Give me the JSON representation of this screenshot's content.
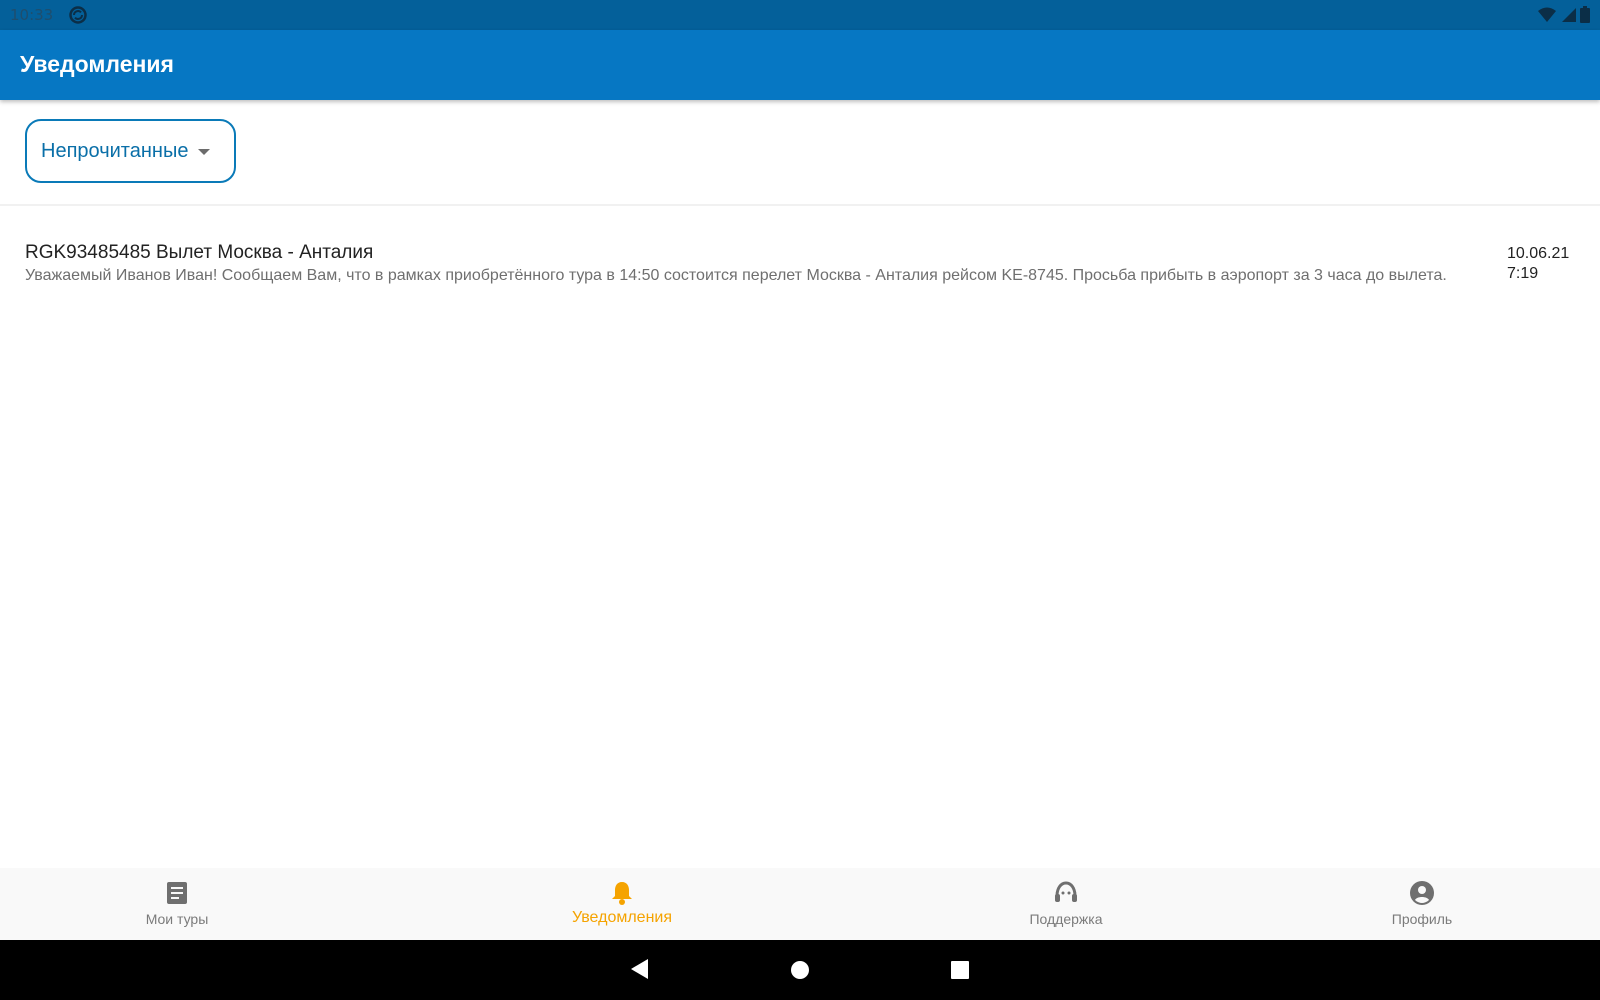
{
  "status_bar": {
    "time": "10:33"
  },
  "app_bar": {
    "title": "Уведомления"
  },
  "filter": {
    "selected": "Непрочитанные"
  },
  "notifications": [
    {
      "title": "RGK93485485 Вылет Москва - Анталия",
      "body": "Уважаемый Иванов Иван! Сообщаем Вам, что в рамках приобретённого тура в 14:50 состоится перелет Москва - Анталия рейсом KE-8745. Просьба прибыть в аэропорт за 3 часа до вылета.",
      "date": "10.06.21",
      "time": "7:19"
    }
  ],
  "bottom_nav": {
    "items": [
      {
        "label": "Мои туры",
        "icon": "document-icon",
        "active": false
      },
      {
        "label": "Уведомления",
        "icon": "bell-icon",
        "active": true
      },
      {
        "label": "Поддержка",
        "icon": "headset-icon",
        "active": false
      },
      {
        "label": "Профиль",
        "icon": "account-circle-icon",
        "active": false
      }
    ]
  },
  "colors": {
    "status_bar": "#04609a",
    "app_bar": "#0677c3",
    "accent_active": "#f5a300",
    "filter_border": "#0a7ab8",
    "inactive_nav": "#7b7b7b"
  }
}
